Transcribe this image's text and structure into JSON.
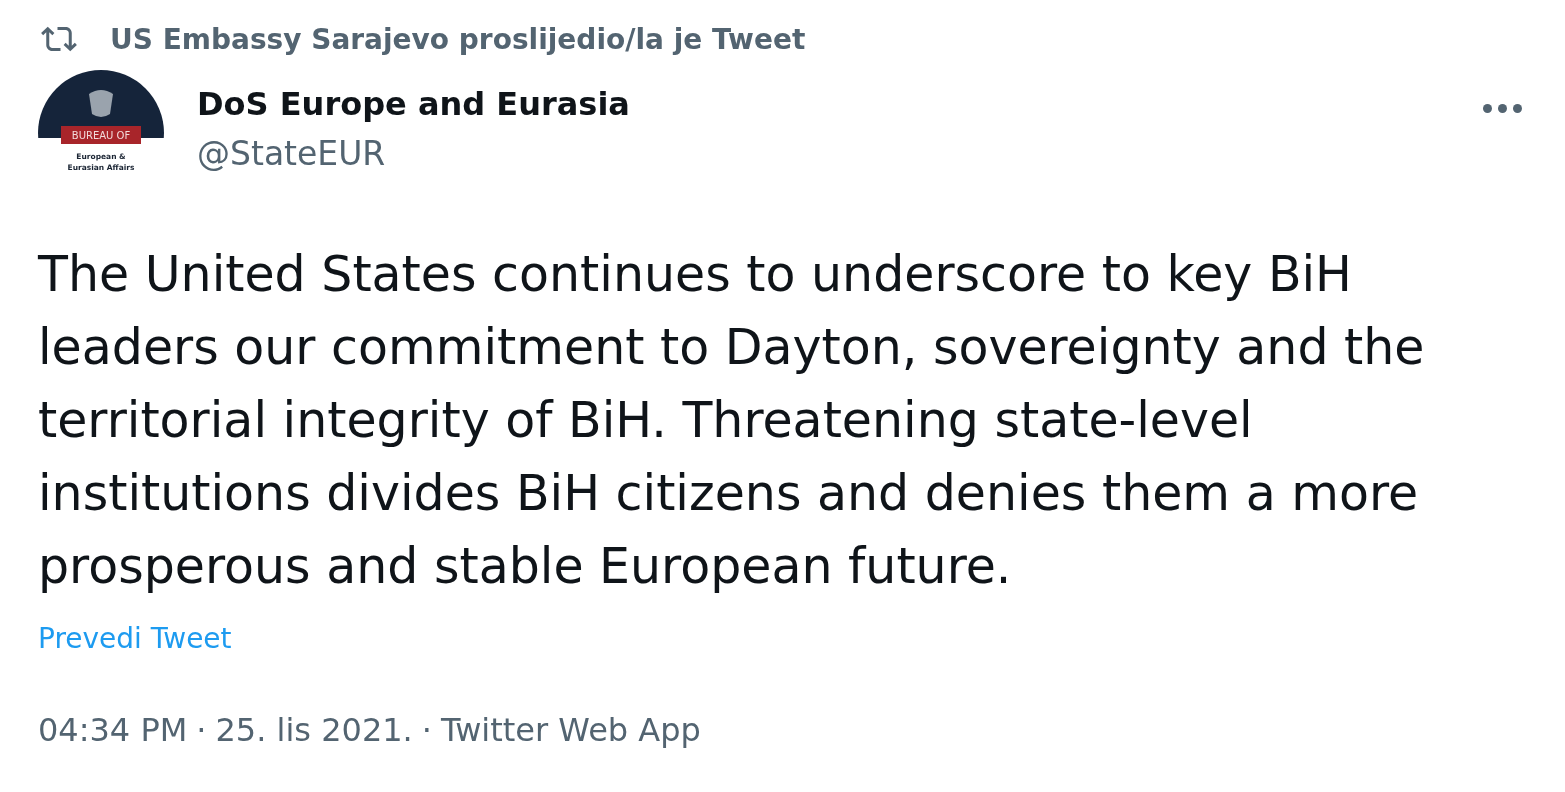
{
  "retweet_banner": {
    "text": "US Embassy Sarajevo proslijedio/la je Tweet"
  },
  "author": {
    "name": "DoS Europe and Eurasia",
    "handle": "@StateEUR",
    "avatar": {
      "banner": "BUREAU OF",
      "lines": [
        "European &",
        "Eurasian Affairs"
      ]
    }
  },
  "tweet": {
    "text": "The United States continues to underscore to key BiH leaders our commitment to Dayton, sovereignty and the territorial integrity of BiH. Threatening state-level institutions divides BiH citizens and denies them a more prosperous and stable European future.",
    "translate_link": "Prevedi Tweet"
  },
  "meta": {
    "time": "04:34 PM",
    "date": "25. lis 2021.",
    "source": "Twitter Web App",
    "separators": [
      "·",
      "·"
    ]
  }
}
